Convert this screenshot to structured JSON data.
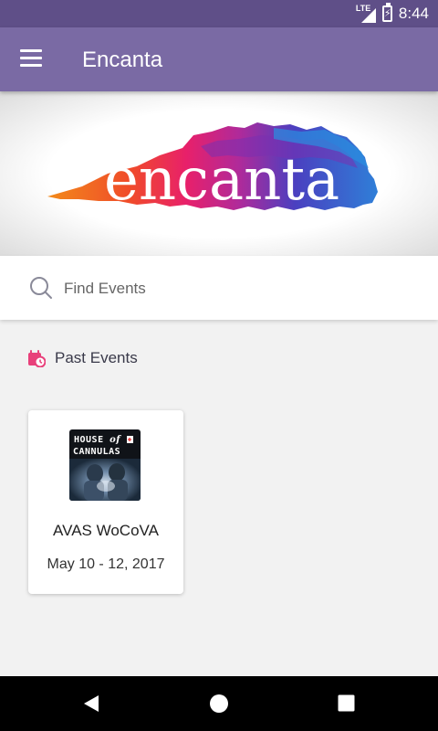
{
  "status_bar": {
    "network": "LTE",
    "time": "8:44"
  },
  "app_bar": {
    "title": "Encanta",
    "menu_icon": "menu-icon"
  },
  "banner": {
    "logo_text": "encanta"
  },
  "search": {
    "placeholder": "Find Events",
    "value": "",
    "icon": "search-icon"
  },
  "past_events": {
    "title": "Past Events",
    "icon": "calendar-clock-icon",
    "accent": "#e8407a",
    "items": [
      {
        "name": "AVAS WoCoVA",
        "date": "May 10 - 12, 2017",
        "thumb_line1_a": "HOUSE",
        "thumb_line1_b": "of",
        "thumb_line2": "CANNULAS"
      }
    ]
  },
  "colors": {
    "status_bar": "#5f4f88",
    "app_bar": "#7a6aa4",
    "background": "#f2f2f2"
  },
  "nav": {
    "back_icon": "back-icon",
    "home_icon": "home-icon",
    "recents_icon": "recents-icon"
  }
}
